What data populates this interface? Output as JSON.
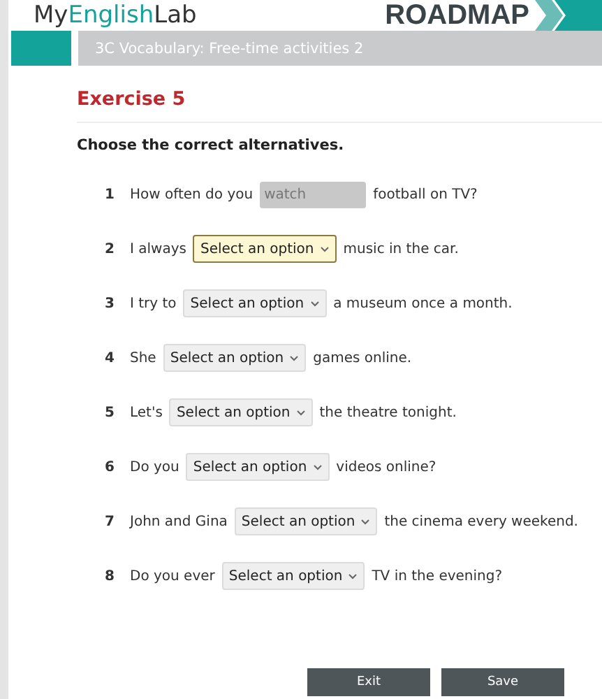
{
  "header": {
    "logo_parts": [
      "My",
      "English",
      "Lab"
    ],
    "brand": "ROADMAP"
  },
  "title_bar": {
    "title": "3C Vocabulary: Free-time activities 2"
  },
  "exercise": {
    "heading": "Exercise 5",
    "instruction": "Choose the correct alternatives.",
    "items": [
      {
        "number": "1",
        "before": "How often do you",
        "gap": {
          "kind": "text",
          "value": "watch",
          "focused": false
        },
        "after": "football on TV?"
      },
      {
        "number": "2",
        "before": "I always",
        "gap": {
          "kind": "select",
          "value": "Select an option",
          "focused": true
        },
        "after": "music in the car."
      },
      {
        "number": "3",
        "before": "I try to",
        "gap": {
          "kind": "select",
          "value": "Select an option",
          "focused": false
        },
        "after": "a museum once a month."
      },
      {
        "number": "4",
        "before": "She",
        "gap": {
          "kind": "select",
          "value": "Select an option",
          "focused": false
        },
        "after": "games online."
      },
      {
        "number": "5",
        "before": "Let's",
        "gap": {
          "kind": "select",
          "value": "Select an option",
          "focused": false
        },
        "after": "the theatre tonight."
      },
      {
        "number": "6",
        "before": "Do you",
        "gap": {
          "kind": "select",
          "value": "Select an option",
          "focused": false
        },
        "after": "videos online?"
      },
      {
        "number": "7",
        "before": "John and Gina",
        "gap": {
          "kind": "select",
          "value": "Select an option",
          "focused": false
        },
        "after": "the cinema every weekend."
      },
      {
        "number": "8",
        "before": "Do you ever",
        "gap": {
          "kind": "select",
          "value": "Select an option",
          "focused": false
        },
        "after": "TV in the evening?"
      }
    ]
  },
  "buttons": [
    "Exit",
    "Save"
  ]
}
